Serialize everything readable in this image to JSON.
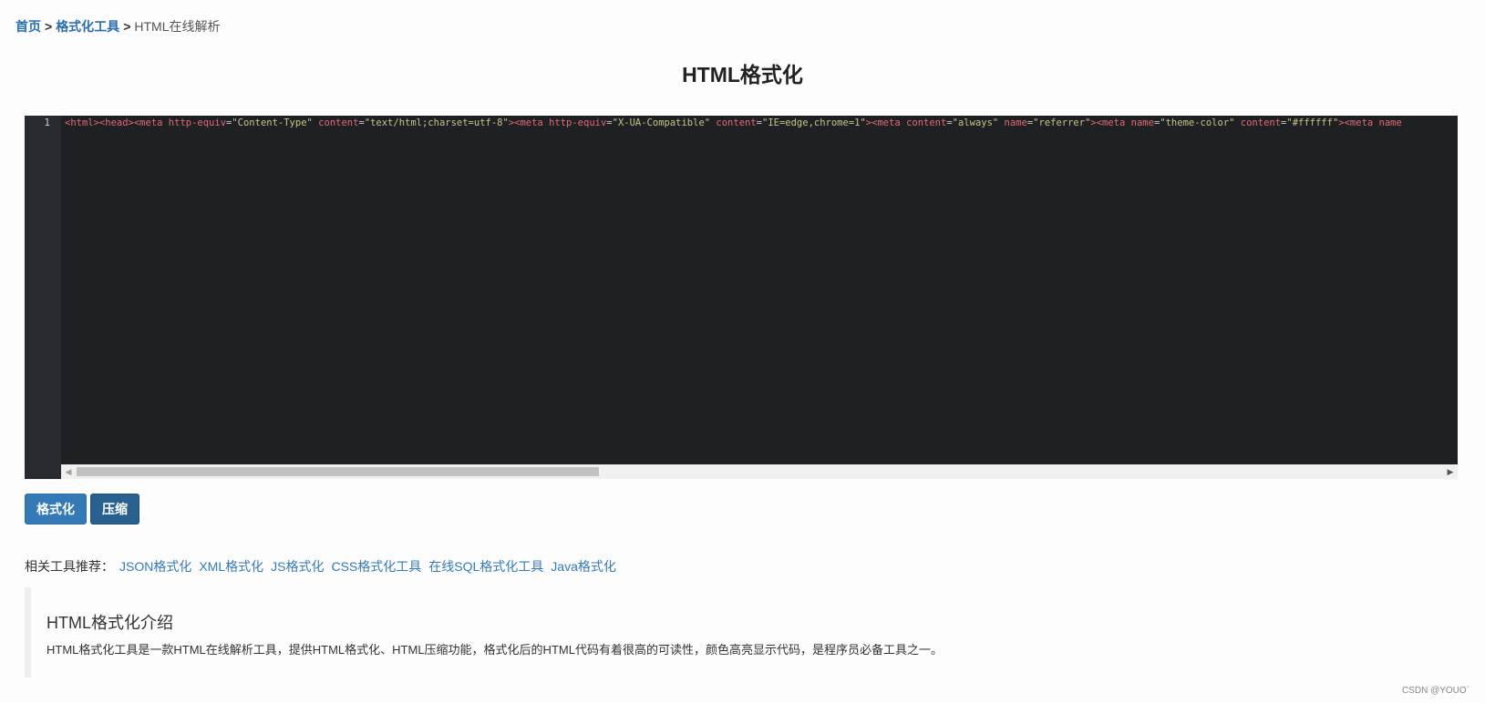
{
  "breadcrumb": {
    "home": "首页",
    "separator": ">",
    "section": "格式化工具",
    "current": "HTML在线解析"
  },
  "page": {
    "title": "HTML格式化"
  },
  "editor": {
    "line_number": "1",
    "code_tokens": [
      {
        "t": "<html><head><meta ",
        "c": "tag"
      },
      {
        "t": "http-equiv",
        "c": "attr"
      },
      {
        "t": "=",
        "c": "punct"
      },
      {
        "t": "\"Content-Type\"",
        "c": "val"
      },
      {
        "t": " content",
        "c": "attr"
      },
      {
        "t": "=",
        "c": "punct"
      },
      {
        "t": "\"text/html;charset=utf-8\"",
        "c": "val"
      },
      {
        "t": "><meta ",
        "c": "tag"
      },
      {
        "t": "http-equiv",
        "c": "attr"
      },
      {
        "t": "=",
        "c": "punct"
      },
      {
        "t": "\"X-UA-Compatible\"",
        "c": "val"
      },
      {
        "t": " content",
        "c": "attr"
      },
      {
        "t": "=",
        "c": "punct"
      },
      {
        "t": "\"IE=edge,chrome=1\"",
        "c": "val"
      },
      {
        "t": "><meta ",
        "c": "tag"
      },
      {
        "t": "content",
        "c": "attr"
      },
      {
        "t": "=",
        "c": "punct"
      },
      {
        "t": "\"always\"",
        "c": "val"
      },
      {
        "t": " name",
        "c": "attr"
      },
      {
        "t": "=",
        "c": "punct"
      },
      {
        "t": "\"referrer\"",
        "c": "val"
      },
      {
        "t": "><meta ",
        "c": "tag"
      },
      {
        "t": "name",
        "c": "attr"
      },
      {
        "t": "=",
        "c": "punct"
      },
      {
        "t": "\"theme-color\"",
        "c": "val"
      },
      {
        "t": " content",
        "c": "attr"
      },
      {
        "t": "=",
        "c": "punct"
      },
      {
        "t": "\"#ffffff\"",
        "c": "val"
      },
      {
        "t": "><meta name",
        "c": "tag"
      }
    ],
    "scroll_left_icon": "triangle-left",
    "scroll_right_icon": "triangle-right"
  },
  "buttons": {
    "format_label": "格式化",
    "compress_label": "压缩"
  },
  "related": {
    "label": "相关工具推荐：",
    "links": [
      "JSON格式化",
      "XML格式化",
      "JS格式化",
      "CSS格式化工具",
      "在线SQL格式化工具",
      "Java格式化"
    ]
  },
  "intro": {
    "heading": "HTML格式化介绍",
    "body": "HTML格式化工具是一款HTML在线解析工具，提供HTML格式化、HTML压缩功能，格式化后的HTML代码有着很高的可读性，颜色高亮显示代码，是程序员必备工具之一。"
  },
  "watermark": "CSDN @YOUO`",
  "colors": {
    "link": "#337ab7",
    "button_primary": "#337ab7",
    "button_active": "#286090",
    "editor_bg": "#1f2023",
    "gutter_bg": "#272a2e",
    "code_tag": "#e06c75",
    "code_value": "#c9c587"
  }
}
